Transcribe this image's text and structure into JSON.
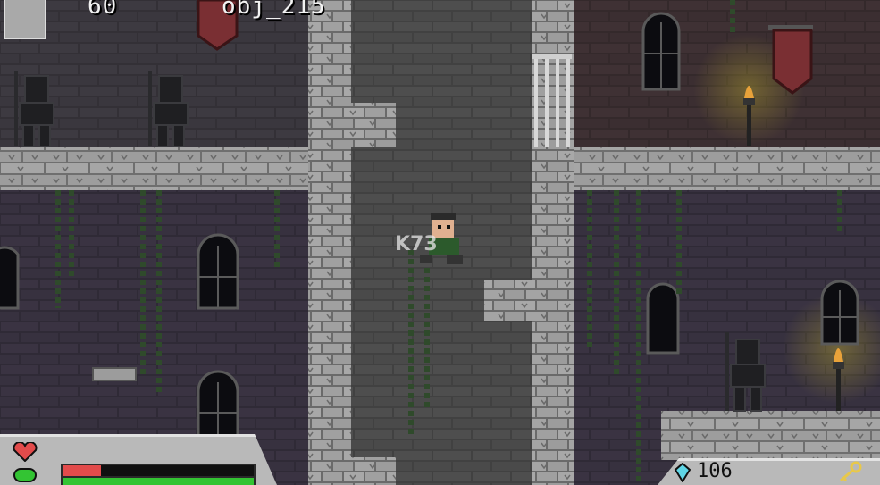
{
  "hud": {
    "fps": "60",
    "object_label": "obj_215",
    "health_fraction": 0.2,
    "stamina_fraction": 1.0,
    "gem_count": "106"
  },
  "colors": {
    "health": "#e24b4b",
    "stamina": "#33c433",
    "gem": "#5fd6e6",
    "key": "#e8c84a"
  },
  "icons": [
    "heart-icon",
    "stamina-gem-icon",
    "gem-icon",
    "key-icon"
  ]
}
